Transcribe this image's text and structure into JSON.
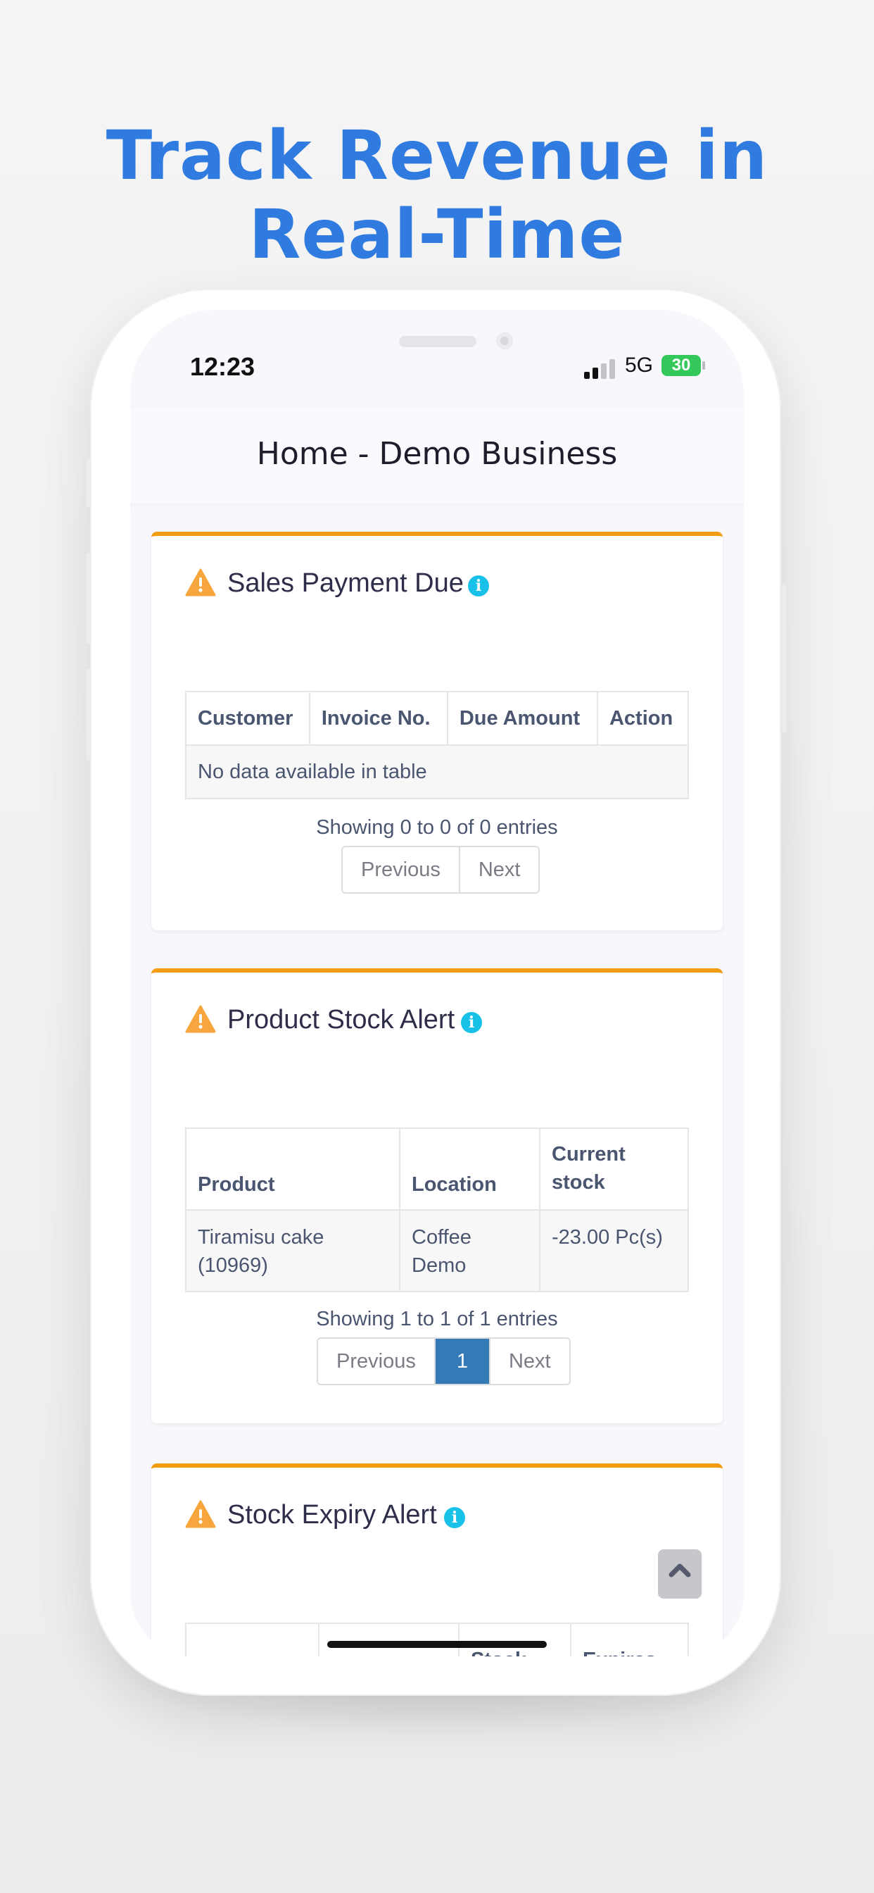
{
  "headline": {
    "line1": "Track Revenue in",
    "line2": "Real-Time"
  },
  "status_bar": {
    "time": "12:23",
    "network": "5G",
    "battery": "30"
  },
  "app_bar": {
    "title": "Home - Demo Business"
  },
  "sales_payment_due": {
    "title": "Sales Payment Due",
    "columns": [
      "Customer",
      "Invoice No.",
      "Due Amount",
      "Action"
    ],
    "empty_text": "No data available in table",
    "info": "Showing 0 to 0 of 0 entries",
    "prev": "Previous",
    "next": "Next"
  },
  "product_stock_alert": {
    "title": "Product Stock Alert",
    "columns": [
      "Product",
      "Location",
      "Current stock"
    ],
    "rows": [
      {
        "product": "Tiramisu cake (10969)",
        "location": "Coffee Demo",
        "stock": "-23.00 Pc(s)"
      }
    ],
    "info": "Showing 1 to 1 of 1 entries",
    "prev": "Previous",
    "page": "1",
    "next": "Next"
  },
  "stock_expiry_alert": {
    "title": "Stock Expiry Alert",
    "visible_columns": [
      "Stock",
      "Expires"
    ]
  },
  "colors": {
    "accent_blue": "#2f7be0",
    "card_border": "#f39c12",
    "info_badge": "#17c1e8",
    "pager_active": "#337ab7",
    "battery": "#34c759"
  },
  "icons": [
    "warning-icon",
    "info-icon",
    "chevron-up-icon",
    "signal-icon",
    "battery-icon"
  ]
}
